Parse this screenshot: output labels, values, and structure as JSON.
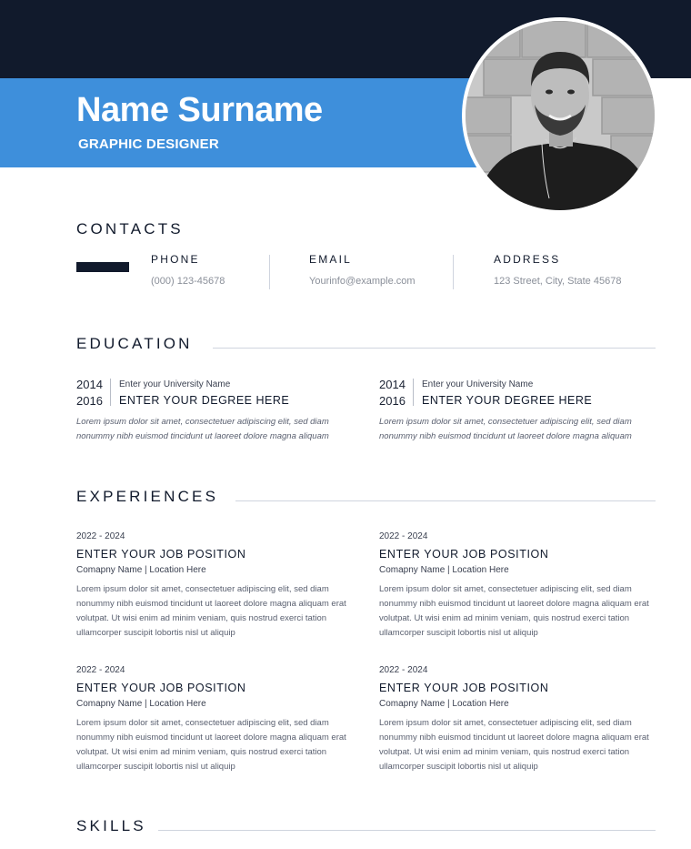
{
  "header": {
    "name": "Name Surname",
    "role": "GRAPHIC DESIGNER",
    "colors": {
      "dark": "#111a2c",
      "accent": "#3e8fdb"
    }
  },
  "contacts": {
    "title": "CONTACTS",
    "phone_label": "PHONE",
    "phone_value": "(000) 123-45678",
    "email_label": "EMAIL",
    "email_value": "Yourinfo@example.com",
    "address_label": "ADDRESS",
    "address_value": "123 Street, City, State 45678"
  },
  "education": {
    "title": "EDUCATION",
    "items": [
      {
        "year_start": "2014",
        "year_end": "2016",
        "university": "Enter your University Name",
        "degree": "ENTER YOUR DEGREE HERE",
        "description": "Lorem ipsum dolor sit amet, consectetuer adipiscing elit, sed diam nonummy nibh euismod tincidunt ut laoreet dolore magna aliquam"
      },
      {
        "year_start": "2014",
        "year_end": "2016",
        "university": "Enter your University Name",
        "degree": "ENTER YOUR DEGREE HERE",
        "description": "Lorem ipsum dolor sit amet, consectetuer adipiscing elit, sed diam nonummy nibh euismod tincidunt ut laoreet dolore magna aliquam"
      }
    ]
  },
  "experiences": {
    "title": "EXPERIENCES",
    "items": [
      {
        "dates": "2022 - 2024",
        "position": "ENTER YOUR JOB POSITION",
        "company": "Comapny Name | Location Here",
        "description": "Lorem ipsum dolor sit amet, consectetuer adipiscing elit, sed diam nonummy nibh euismod tincidunt ut laoreet dolore magna aliquam erat volutpat. Ut wisi enim ad minim veniam, quis nostrud exerci tation ullamcorper suscipit lobortis nisl ut aliquip"
      },
      {
        "dates": "2022 - 2024",
        "position": "ENTER YOUR JOB POSITION",
        "company": "Comapny Name | Location Here",
        "description": "Lorem ipsum dolor sit amet, consectetuer adipiscing elit, sed diam nonummy nibh euismod tincidunt ut laoreet dolore magna aliquam erat volutpat. Ut wisi enim ad minim veniam, quis nostrud exerci tation ullamcorper suscipit lobortis nisl ut aliquip"
      },
      {
        "dates": "2022 - 2024",
        "position": "ENTER YOUR JOB POSITION",
        "company": "Comapny Name | Location Here",
        "description": "Lorem ipsum dolor sit amet, consectetuer adipiscing elit, sed diam nonummy nibh euismod tincidunt ut laoreet dolore magna aliquam erat volutpat. Ut wisi enim ad minim veniam, quis nostrud exerci tation ullamcorper suscipit lobortis nisl ut aliquip"
      },
      {
        "dates": "2022 - 2024",
        "position": "ENTER YOUR JOB POSITION",
        "company": "Comapny Name | Location Here",
        "description": "Lorem ipsum dolor sit amet, consectetuer adipiscing elit, sed diam nonummy nibh euismod tincidunt ut laoreet dolore magna aliquam erat volutpat. Ut wisi enim ad minim veniam, quis nostrud exerci tation ullamcorper suscipit lobortis nisl ut aliquip"
      }
    ]
  },
  "skills": {
    "title": "SKILLS"
  }
}
